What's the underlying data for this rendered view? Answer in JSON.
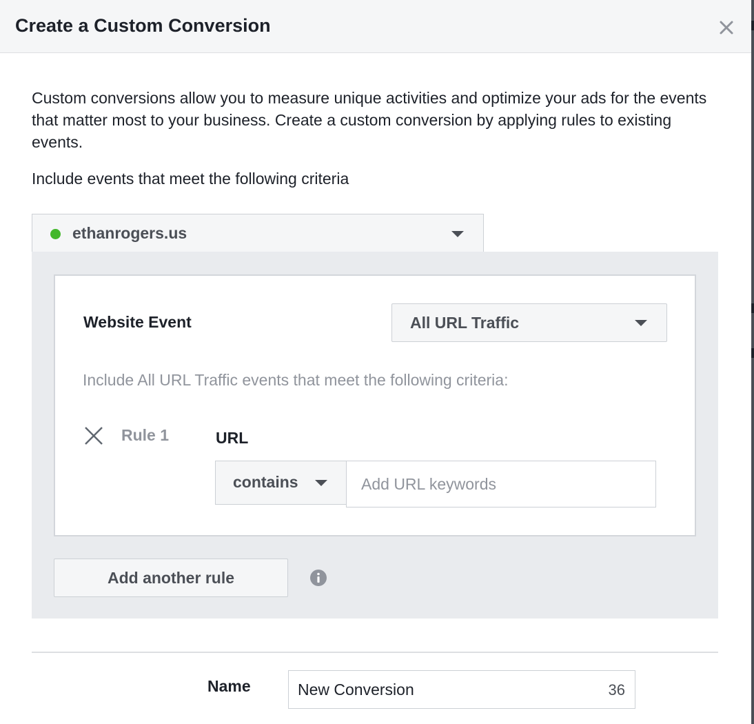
{
  "dialog": {
    "title": "Create a Custom Conversion",
    "close_icon": "close-icon",
    "intro": "Custom conversions allow you to measure unique activities and optimize your ads for the events that matter most to your business. Create a custom conversion by applying rules to existing events.",
    "criteria_label": "Include events that meet the following criteria"
  },
  "pixel": {
    "selected": "ethanrogers.us",
    "status_color": "#42b72a"
  },
  "rule_builder": {
    "event_label": "Website Event",
    "event_selected": "All URL Traffic",
    "include_note": "Include All URL Traffic events that meet the following criteria:",
    "rules": [
      {
        "label": "Rule 1",
        "field": "URL",
        "operator": "contains",
        "value": "",
        "placeholder": "Add URL keywords"
      }
    ],
    "add_rule_label": "Add another rule",
    "info_icon": "info-icon"
  },
  "name_field": {
    "label": "Name",
    "value": "New Conversion",
    "char_count": "36"
  },
  "colors": {
    "header_bg": "#f5f6f7",
    "panel_bg": "#e9ebee",
    "muted_text": "#90949c"
  }
}
